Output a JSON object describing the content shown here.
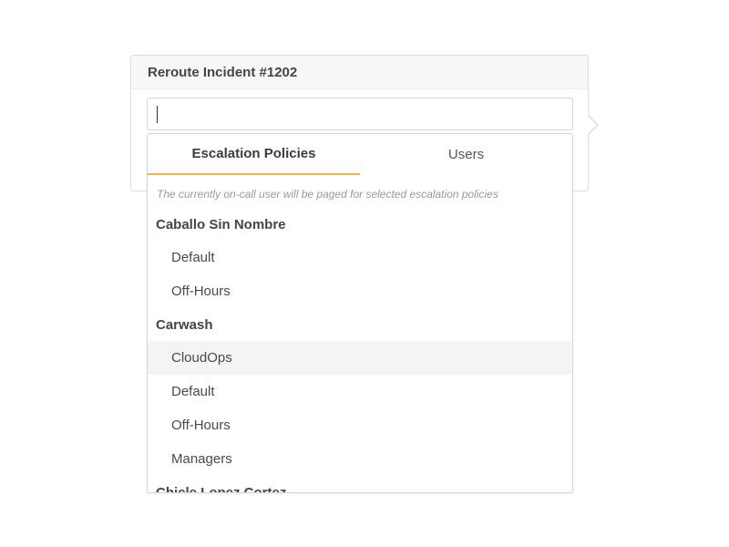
{
  "modal": {
    "title": "Reroute Incident #1202"
  },
  "search": {
    "value": "",
    "placeholder": ""
  },
  "tabs": [
    {
      "label": "Escalation Policies",
      "active": true
    },
    {
      "label": "Users",
      "active": false
    }
  ],
  "hint": "The currently on-call user will be paged for selected escalation policies",
  "groups": [
    {
      "name": "Caballo Sin Nombre",
      "items": [
        "Default",
        "Off-Hours"
      ]
    },
    {
      "name": "Carwash",
      "items": [
        "CloudOps",
        "Default",
        "Off-Hours",
        "Managers"
      ]
    },
    {
      "name": "Chicle Lopez Cortez",
      "items": []
    }
  ],
  "highlighted_item": "CloudOps",
  "colors": {
    "active_tab_underline": "#f0b44c",
    "highlight_row": "#f4f4f4"
  }
}
